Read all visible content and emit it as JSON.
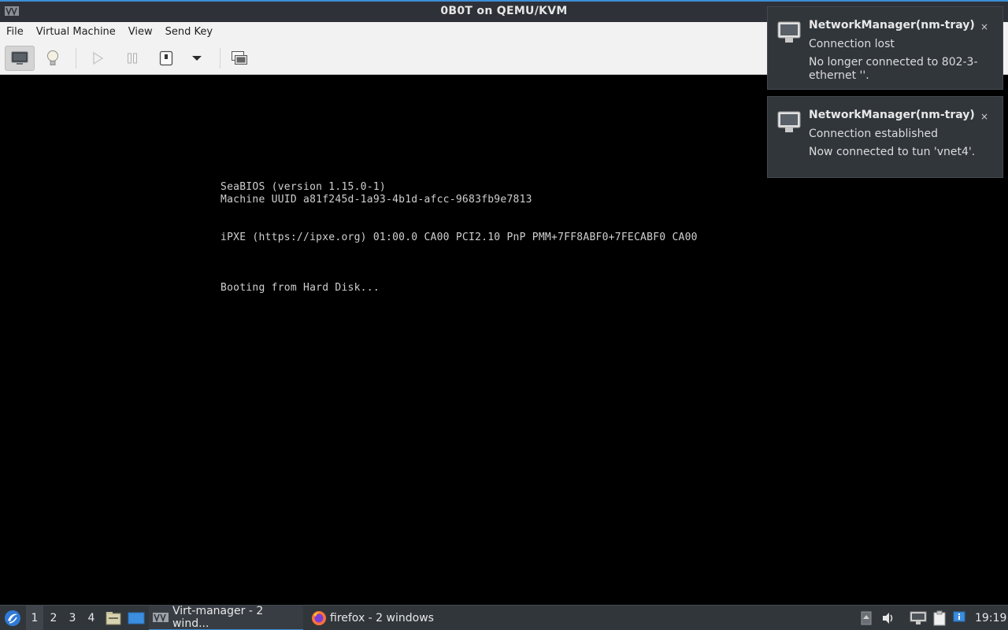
{
  "window": {
    "title": "0B0T on QEMU/KVM"
  },
  "menu": [
    "File",
    "Virtual Machine",
    "View",
    "Send Key"
  ],
  "toolbar": {
    "icons": [
      "console-icon",
      "details-lightbulb-icon",
      "run-icon",
      "pause-icon",
      "shutdown-icon",
      "shutdown-menu-icon",
      "screenshot-icon"
    ]
  },
  "console": {
    "lines": [
      "SeaBIOS (version 1.15.0-1)",
      "Machine UUID a81f245d-1a93-4b1d-afcc-9683fb9e7813",
      "iPXE (https://ipxe.org) 01:00.0 CA00 PCI2.10 PnP PMM+7FF8ABF0+7FECABF0 CA00",
      "Booting from Hard Disk..."
    ]
  },
  "notifications": [
    {
      "app": "NetworkManager(nm-tray)",
      "summary": "Connection lost",
      "body": "No longer connected to 802-3-ethernet ''.",
      "close": "×"
    },
    {
      "app": "NetworkManager(nm-tray)",
      "summary": "Connection established",
      "body": "Now connected to tun 'vnet4'.",
      "close": "×"
    }
  ],
  "taskbar": {
    "desktops": [
      "1",
      "2",
      "3",
      "4"
    ],
    "tasks": [
      "Virt-manager - 2 wind...",
      "firefox - 2 windows"
    ],
    "clock": "19:19"
  },
  "colors": {
    "accent": "#3d8ed8",
    "panel": "#31363b",
    "console_text": "#cfcfcf"
  }
}
